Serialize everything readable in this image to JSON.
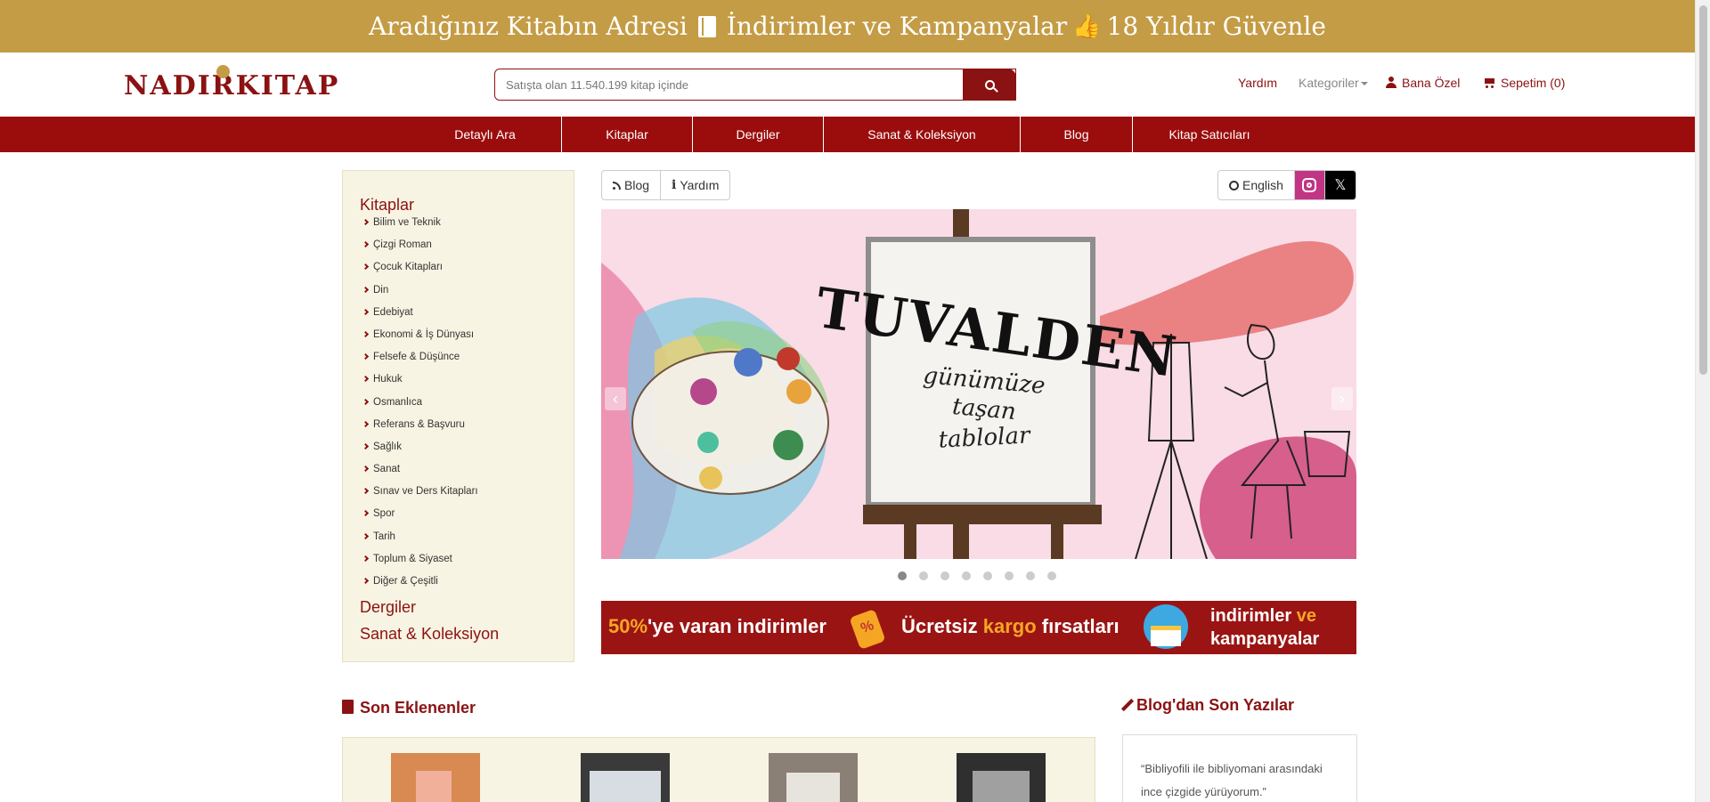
{
  "promo": {
    "part1": "Aradığınız Kitabın Adresi",
    "part2": "İndirimler ve Kampanyalar",
    "part3": "18 Yıldır Güvenle"
  },
  "header": {
    "logo": "NADIRKITAP",
    "search_placeholder": "Satışta olan 11.540.199 kitap içinde",
    "links": {
      "yardim": "Yardım",
      "kategoriler": "Kategoriler",
      "bana_ozel": "Bana Özel",
      "sepetim": "Sepetim (0)"
    }
  },
  "nav": [
    "Detaylı Ara",
    "Kitaplar",
    "Dergiler",
    "Sanat & Koleksiyon",
    "Blog",
    "Kitap Satıcıları"
  ],
  "sidebar": {
    "kitaplar": "Kitaplar",
    "items": [
      "Bilim ve Teknik",
      "Çizgi Roman",
      "Çocuk Kitapları",
      "Din",
      "Edebiyat",
      "Ekonomi & İş Dünyası",
      "Felsefe & Düşünce",
      "Hukuk",
      "Osmanlıca",
      "Referans & Başvuru",
      "Sağlık",
      "Sanat",
      "Sınav ve Ders Kitapları",
      "Spor",
      "Tarih",
      "Toplum & Siyaset",
      "Diğer & Çeşitli"
    ],
    "dergiler": "Dergiler",
    "sanat": "Sanat & Koleksiyon"
  },
  "toolbar": {
    "blog": "Blog",
    "yardim": "Yardım",
    "english": "English",
    "x": "𝕏"
  },
  "slider": {
    "headline": "TUVALDEN",
    "line1": "günümüze",
    "line2": "taşan",
    "line3": "tablolar",
    "slide_count": 8,
    "active_index": 0
  },
  "banner": {
    "pct": "50%",
    "t1": "'ye varan indirimler",
    "t2a": "Ücretsiz ",
    "t2b": "kargo",
    "t2c": " fırsatları",
    "t3a": "indirimler ",
    "t3b": "ve",
    "t3c": "kampanyalar"
  },
  "sections": {
    "son_eklenenler": "Son Eklenenler",
    "blog_son": "Blog'dan Son Yazılar",
    "blog_quote": "“Bibliyofili ile bibliyomani arasındaki ince çizgide yürüyorum.”"
  },
  "colors": {
    "brand": "#8b1212",
    "nav": "#9b0d0d",
    "gold": "#c49c45",
    "cream": "#f8f4e3"
  }
}
